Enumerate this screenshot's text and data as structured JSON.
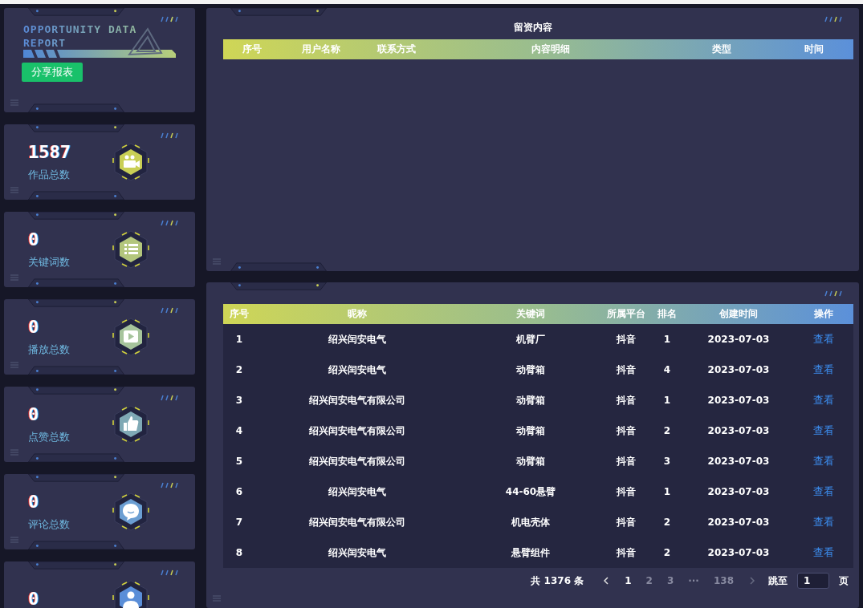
{
  "logo": {
    "title": "OPPORTUNITY DATA REPORT",
    "share_button": "分享报表"
  },
  "stats": [
    {
      "value": "1587",
      "label": "作品总数",
      "color": "#c9cf55"
    },
    {
      "value": "0",
      "label": "关键词数",
      "color": "#b3c67c"
    },
    {
      "value": "0",
      "label": "播放总数",
      "color": "#a6c49c"
    },
    {
      "value": "0",
      "label": "点赞总数",
      "color": "#7fa9b5"
    },
    {
      "value": "0",
      "label": "评论总数",
      "color": "#6b9ed2"
    },
    {
      "value": "0",
      "color": "#5a8ed8"
    }
  ],
  "leads": {
    "title": "留资内容",
    "columns": [
      "序号",
      "用户名称",
      "联系方式",
      "内容明细",
      "类型",
      "时间"
    ]
  },
  "keywords": {
    "columns": [
      "序号",
      "昵称",
      "关键词",
      "所属平台",
      "排名",
      "创建时间",
      "操作"
    ],
    "rows": [
      {
        "index": "1",
        "nickname": "绍兴闰安电气",
        "keyword": "机臂厂",
        "platform": "抖音",
        "rank": "1",
        "created": "2023-07-03",
        "action": "查看"
      },
      {
        "index": "2",
        "nickname": "绍兴闰安电气",
        "keyword": "动臂箱",
        "platform": "抖音",
        "rank": "4",
        "created": "2023-07-03",
        "action": "查看"
      },
      {
        "index": "3",
        "nickname": "绍兴闰安电气有限公司",
        "keyword": "动臂箱",
        "platform": "抖音",
        "rank": "1",
        "created": "2023-07-03",
        "action": "查看"
      },
      {
        "index": "4",
        "nickname": "绍兴闰安电气有限公司",
        "keyword": "动臂箱",
        "platform": "抖音",
        "rank": "2",
        "created": "2023-07-03",
        "action": "查看"
      },
      {
        "index": "5",
        "nickname": "绍兴闰安电气有限公司",
        "keyword": "动臂箱",
        "platform": "抖音",
        "rank": "3",
        "created": "2023-07-03",
        "action": "查看"
      },
      {
        "index": "6",
        "nickname": "绍兴闰安电气",
        "keyword": "44-60悬臂",
        "platform": "抖音",
        "rank": "1",
        "created": "2023-07-03",
        "action": "查看"
      },
      {
        "index": "7",
        "nickname": "绍兴闰安电气有限公司",
        "keyword": "机电壳体",
        "platform": "抖音",
        "rank": "2",
        "created": "2023-07-03",
        "action": "查看"
      },
      {
        "index": "8",
        "nickname": "绍兴闰安电气",
        "keyword": "悬臂组件",
        "platform": "抖音",
        "rank": "2",
        "created": "2023-07-03",
        "action": "查看"
      }
    ]
  },
  "pagination": {
    "total": "共 1376 条",
    "prev_disabled": false,
    "next_disabled": true,
    "pages": [
      {
        "label": "1",
        "selected": true
      },
      {
        "label": "2",
        "selected": false
      },
      {
        "label": "3",
        "selected": false
      },
      {
        "label": "···",
        "selected": false
      },
      {
        "label": "138",
        "selected": false
      }
    ],
    "jump_label": "跳至",
    "jump_value": "1",
    "page_suffix": "页"
  }
}
